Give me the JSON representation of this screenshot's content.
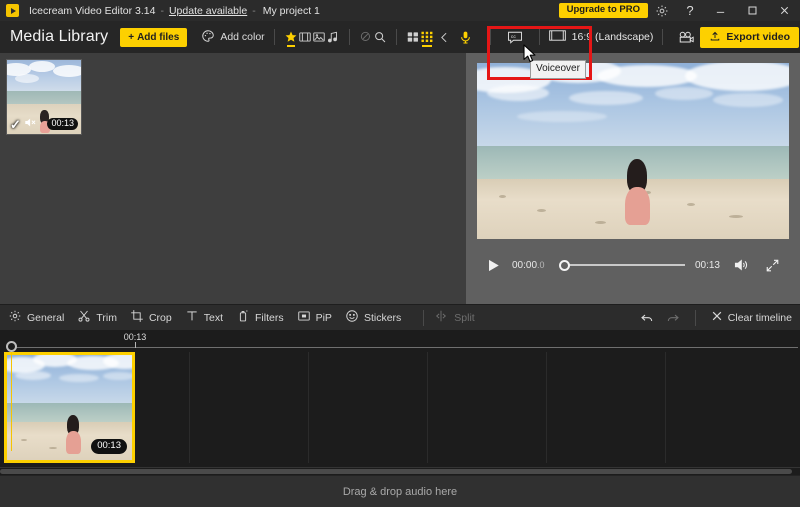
{
  "titlebar": {
    "app_name": "Icecream Video Editor 3.14",
    "sep": "-",
    "update_link": "Update available",
    "project_name": "My project 1",
    "pro_button": "Upgrade to PRO",
    "settings_icon": "gear-icon",
    "help_icon": "question-mark-icon",
    "minimize": "–",
    "maximize": "☐",
    "close": "✕"
  },
  "library_toolbar": {
    "title": "Media Library",
    "add_files": "Add files",
    "add_files_plus": "+",
    "add_color": "Add color",
    "filters": [
      {
        "name": "favorites-filter-icon",
        "icon": "star",
        "active": true
      },
      {
        "name": "video-filter-icon",
        "icon": "film",
        "active": false
      },
      {
        "name": "image-filter-icon",
        "icon": "picture",
        "active": false
      },
      {
        "name": "audio-filter-icon",
        "icon": "music-note",
        "active": false
      },
      {
        "name": "hidden-filter-icon",
        "icon": "eye-off",
        "active": false,
        "dim": true
      },
      {
        "name": "search-icon",
        "icon": "magnifier",
        "active": false
      }
    ],
    "views": [
      {
        "name": "list-view-icon",
        "active": false
      },
      {
        "name": "grid-view-icon",
        "active": true
      }
    ],
    "collapse_icon": "chevron-left-icon",
    "voiceover_icon": "microphone-icon",
    "captions_icon": "closed-captions-icon",
    "aspect_ratio_icon": "aspect-ratio-icon",
    "aspect_ratio": "16:9 (Landscape)",
    "record_icon": "camera-icon",
    "export_button": "Export video",
    "export_icon": "upload-icon"
  },
  "tooltip": {
    "text": "Voiceover"
  },
  "highlight": {
    "color": "#e51616"
  },
  "media_items": [
    {
      "name": "media-thumb-beach",
      "duration": "00:13",
      "selected_mark": "✓",
      "muted_icon": "speaker-muted-icon"
    }
  ],
  "preview": {
    "play_icon": "play-icon",
    "current_time": "00:00",
    "current_time_frac": ".0",
    "total_time": "00:13",
    "volume_icon": "volume-icon",
    "fullscreen_icon": "fullscreen-icon",
    "progress_percent": 0
  },
  "edit_toolbar": {
    "tools": [
      {
        "label": "General",
        "icon": "gear-icon",
        "enabled": true
      },
      {
        "label": "Trim",
        "icon": "scissors-icon",
        "enabled": true
      },
      {
        "label": "Crop",
        "icon": "crop-icon",
        "enabled": true
      },
      {
        "label": "Text",
        "icon": "text-t-icon",
        "enabled": true
      },
      {
        "label": "Filters",
        "icon": "filters-icon",
        "enabled": true
      },
      {
        "label": "PiP",
        "icon": "picture-in-picture-icon",
        "enabled": true
      },
      {
        "label": "Stickers",
        "icon": "smiley-icon",
        "enabled": true
      },
      {
        "label": "Split",
        "icon": "split-icon",
        "enabled": false
      }
    ],
    "undo_icon": "undo-icon",
    "redo_icon": "redo-icon",
    "clear_label": "Clear timeline",
    "clear_icon": "close-x-icon"
  },
  "timeline": {
    "ruler_label": "00:13",
    "clip": {
      "name": "timeline-clip-beach",
      "duration": "00:13"
    }
  },
  "audio_zone": {
    "placeholder": "Drag & drop audio here"
  }
}
